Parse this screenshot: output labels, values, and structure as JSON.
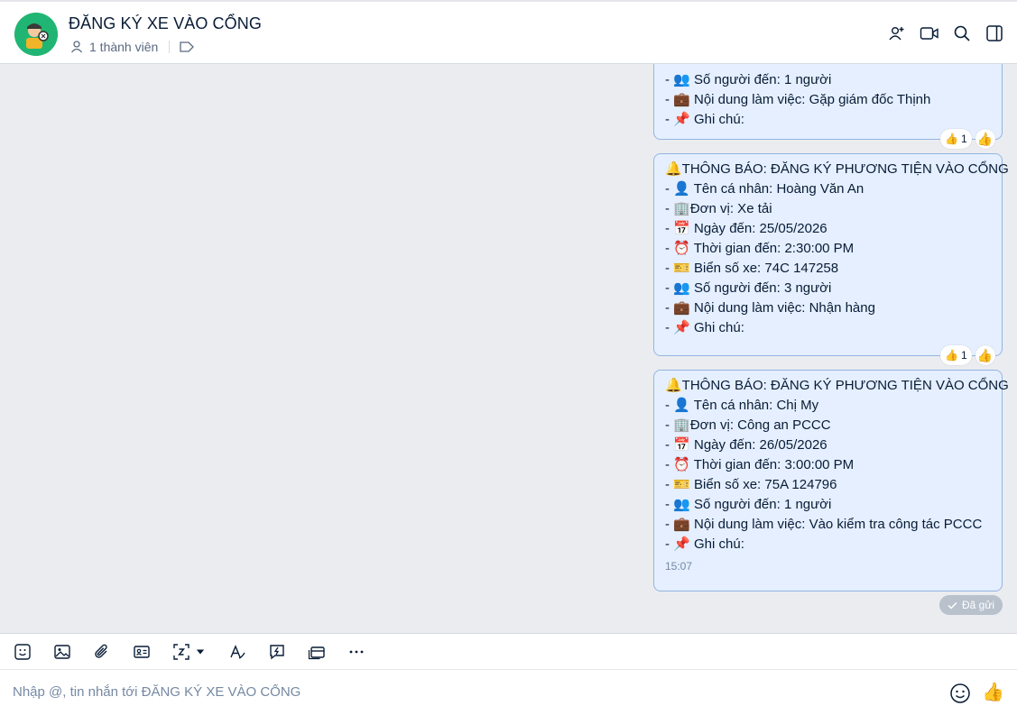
{
  "header": {
    "title": "ĐĂNG KÝ XE VÀO CỔNG",
    "members": "1 thành viên",
    "icons": [
      "add-member-icon",
      "video-call-icon",
      "search-icon",
      "sidebar-toggle-icon"
    ]
  },
  "messages": [
    {
      "lines": [
        "- 👥 Số người đến: 1 người",
        "- 💼 Nội dung làm việc: Gặp giám đốc Thịnh",
        "- 📌 Ghi chú:"
      ],
      "reaction_count": "1"
    },
    {
      "lines": [
        "🔔THÔNG BÁO: ĐĂNG KÝ PHƯƠNG TIỆN VÀO CỔNG",
        "- 👤 Tên cá nhân: Hoàng Văn An",
        "- 🏢Đơn vị: Xe tải",
        "- 📅 Ngày đến: 25/05/2026",
        "- ⏰ Thời gian đến: 2:30:00 PM",
        "- 🎫 Biển số xe: 74C 147258",
        "- 👥 Số người đến: 3 người",
        "- 💼 Nội dung làm việc: Nhận hàng",
        "- 📌 Ghi chú:"
      ],
      "reaction_count": "1"
    },
    {
      "lines": [
        "🔔THÔNG BÁO: ĐĂNG KÝ PHƯƠNG TIỆN VÀO CỔNG",
        "- 👤 Tên cá nhân: Chị My",
        "- 🏢Đơn vị: Công an PCCC",
        "- 📅 Ngày đến: 26/05/2026",
        "- ⏰ Thời gian đến: 3:00:00 PM",
        "- 🎫 Biển số xe: 75A 124796",
        "- 👥 Số người đến: 1 người",
        "- 💼 Nội dung làm việc: Vào kiểm tra công tác PCCC",
        "- 📌 Ghi chú:"
      ],
      "time": "15:07"
    }
  ],
  "status": {
    "sent": "Đã gửi"
  },
  "composer": {
    "placeholder": "Nhập @, tin nhắn tới ĐĂNG KÝ XE VÀO CỔNG",
    "toolbar_icons": [
      "sticker-icon",
      "image-icon",
      "attachment-icon",
      "contact-card-icon",
      "screenshot-icon",
      "format-text-icon",
      "quick-message-icon",
      "card-icon",
      "more-icon"
    ]
  },
  "colors": {
    "accent": "#0068ff",
    "bubble": "#e5efff",
    "avatar_bg": "#21b573"
  }
}
